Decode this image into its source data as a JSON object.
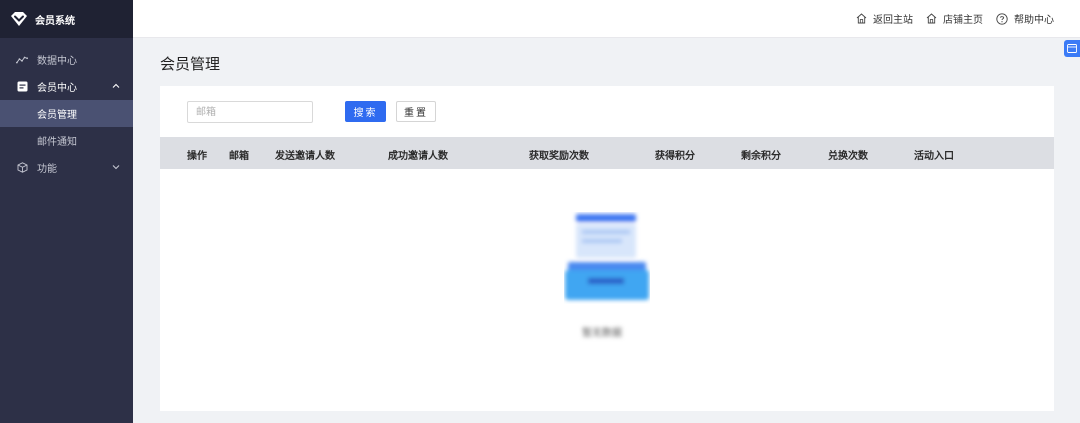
{
  "app": {
    "title": "会员系统"
  },
  "header": {
    "links": [
      {
        "label": "返回主站",
        "icon": "home-icon"
      },
      {
        "label": "店铺主页",
        "icon": "home-icon"
      },
      {
        "label": "帮助中心",
        "icon": "help-circle-icon"
      }
    ]
  },
  "sidebar": {
    "items": [
      {
        "label": "数据中心",
        "icon": "line-chart-icon"
      },
      {
        "label": "会员中心",
        "icon": "member-card-icon",
        "expanded": true,
        "children": [
          {
            "label": "会员管理",
            "active": true
          },
          {
            "label": "邮件通知"
          }
        ]
      },
      {
        "label": "功能",
        "icon": "cube-icon",
        "expanded": false
      }
    ]
  },
  "main": {
    "title": "会员管理",
    "search": {
      "placeholder": "邮箱",
      "value": ""
    },
    "buttons": {
      "search": "搜索",
      "reset": "重置"
    },
    "table": {
      "columns": [
        "操作",
        "邮箱",
        "发送邀请人数",
        "成功邀请人数",
        "获取奖励次数",
        "获得积分",
        "剩余积分",
        "兑换次数",
        "活动入口"
      ],
      "rows": []
    },
    "empty_text": "暂无数据"
  },
  "colors": {
    "sidebar_bg": "#2d3047",
    "logo_bg": "#1f2233",
    "active_item": "#4a5172",
    "primary": "#2f6bf0",
    "table_header": "#dcdee3"
  }
}
